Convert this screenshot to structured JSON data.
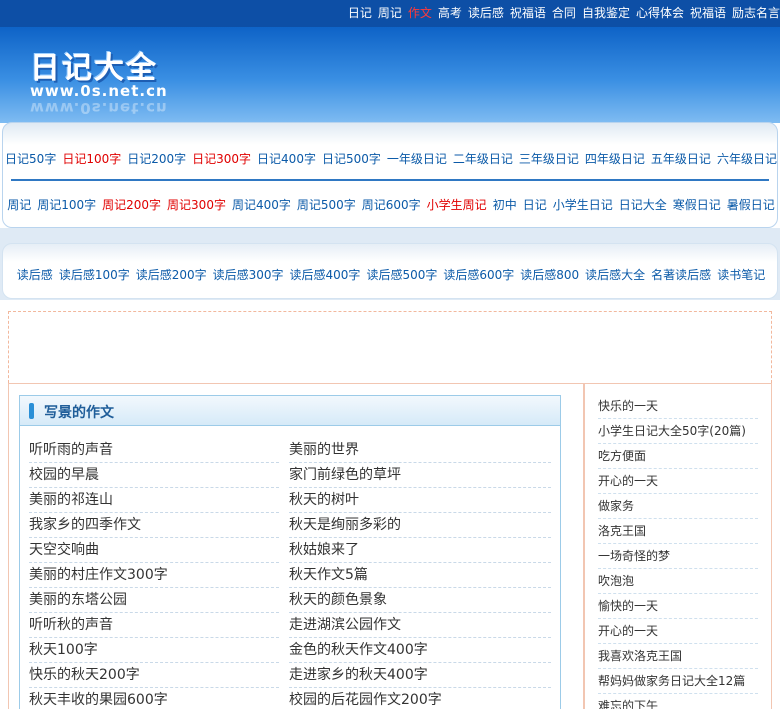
{
  "topnav": [
    {
      "label": "日记",
      "hot": false
    },
    {
      "label": "周记",
      "hot": false
    },
    {
      "label": "作文",
      "hot": true
    },
    {
      "label": "高考",
      "hot": false
    },
    {
      "label": "读后感",
      "hot": false
    },
    {
      "label": "祝福语",
      "hot": false
    },
    {
      "label": "合同",
      "hot": false
    },
    {
      "label": "自我鉴定",
      "hot": false
    },
    {
      "label": "心得体会",
      "hot": false
    },
    {
      "label": "祝福语",
      "hot": false
    },
    {
      "label": "励志名言",
      "hot": false
    }
  ],
  "logo": {
    "title": "日记大全",
    "url": "www.0s.net.cn"
  },
  "nav_row1": [
    {
      "label": "日记50字",
      "red": false
    },
    {
      "label": "日记100字",
      "red": true
    },
    {
      "label": "日记200字",
      "red": false
    },
    {
      "label": "日记300字",
      "red": true
    },
    {
      "label": "日记400字",
      "red": false
    },
    {
      "label": "日记500字",
      "red": false
    },
    {
      "label": "一年级日记",
      "red": false
    },
    {
      "label": "二年级日记",
      "red": false
    },
    {
      "label": "三年级日记",
      "red": false
    },
    {
      "label": "四年级日记",
      "red": false
    },
    {
      "label": "五年级日记",
      "red": false
    },
    {
      "label": "六年级日记",
      "red": false
    }
  ],
  "nav_row2": [
    {
      "label": "周记",
      "red": false
    },
    {
      "label": "周记100字",
      "red": false
    },
    {
      "label": "周记200字",
      "red": true
    },
    {
      "label": "周记300字",
      "red": true
    },
    {
      "label": "周记400字",
      "red": false
    },
    {
      "label": "周记500字",
      "red": false
    },
    {
      "label": "周记600字",
      "red": false
    },
    {
      "label": "小学生周记",
      "red": true
    },
    {
      "label": "初中",
      "red": false
    },
    {
      "label": "日记",
      "red": false
    },
    {
      "label": "小学生日记",
      "red": false
    },
    {
      "label": "日记大全",
      "red": false
    },
    {
      "label": "寒假日记",
      "red": false
    },
    {
      "label": "暑假日记",
      "red": false
    }
  ],
  "nav_row3": [
    {
      "label": "读后感",
      "red": false
    },
    {
      "label": "读后感100字",
      "red": false
    },
    {
      "label": "读后感200字",
      "red": false
    },
    {
      "label": "读后感300字",
      "red": false
    },
    {
      "label": "读后感400字",
      "red": false
    },
    {
      "label": "读后感500字",
      "red": false
    },
    {
      "label": "读后感600字",
      "red": false
    },
    {
      "label": "读后感800",
      "red": false
    },
    {
      "label": "读后感大全",
      "red": false
    },
    {
      "label": "名著读后感",
      "red": false
    },
    {
      "label": "读书笔记",
      "red": false
    }
  ],
  "section": {
    "title": "写景的作文",
    "left": [
      "听听雨的声音",
      "校园的早晨",
      "美丽的祁连山",
      "我家乡的四季作文",
      "天空交响曲",
      "美丽的村庄作文300字",
      "美丽的东塔公园",
      "听听秋的声音",
      "秋天100字",
      "快乐的秋天200字",
      "秋天丰收的果园600字"
    ],
    "right": [
      "美丽的世界",
      "家门前绿色的草坪",
      "秋天的树叶",
      "秋天是绚丽多彩的",
      "秋姑娘来了",
      "秋天作文5篇",
      "秋天的颜色景象",
      "走进湖滨公园作文",
      "金色的秋天作文400字",
      "走进家乡的秋天400字",
      "校园的后花园作文200字"
    ]
  },
  "sidebar": [
    "快乐的一天",
    "小学生日记大全50字(20篇)",
    "吃方便面",
    "开心的一天",
    "做家务",
    "洛克王国",
    "一场奇怪的梦",
    "吹泡泡",
    "愉快的一天",
    "开心的一天",
    "我喜欢洛克王国",
    "帮妈妈做家务日记大全12篇",
    "难忘的下午"
  ]
}
